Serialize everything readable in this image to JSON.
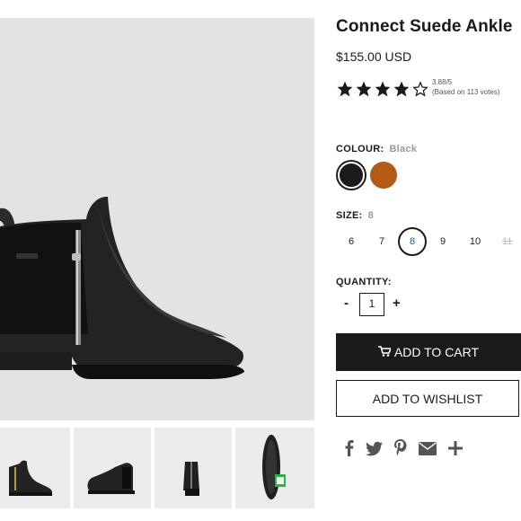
{
  "product": {
    "title": "Connect Suede Ankle",
    "price": "$155.00 USD",
    "rating": {
      "value": "3.88/5",
      "votes_text": "(Based on 113 votes)",
      "stars_filled": 4,
      "stars_total": 5
    }
  },
  "colour": {
    "label": "COLOUR:",
    "selected": "Black",
    "options": [
      {
        "name": "Black",
        "color": "#1b1b1b"
      },
      {
        "name": "Brown",
        "color": "#b35a17"
      }
    ]
  },
  "size": {
    "label": "SIZE:",
    "selected": "8",
    "options": [
      "6",
      "7",
      "8",
      "9",
      "10",
      "11"
    ]
  },
  "quantity": {
    "label": "QUANTITY:",
    "value": "1",
    "minus": "-",
    "plus": "+"
  },
  "buttons": {
    "add_to_cart": "ADD TO CART",
    "add_to_wishlist": "ADD TO WISHLIST"
  },
  "share_icons": [
    "facebook-icon",
    "twitter-icon",
    "pinterest-icon",
    "email-icon",
    "plus-icon"
  ],
  "thumbnails": [
    "boot-side-view",
    "boot-angle-view",
    "boot-back-view",
    "boot-sole-view"
  ],
  "colors": {
    "accent": "#1a1a1a",
    "selected_size_text": "#1a5aa8",
    "image_bg": "#e3e3e3"
  }
}
